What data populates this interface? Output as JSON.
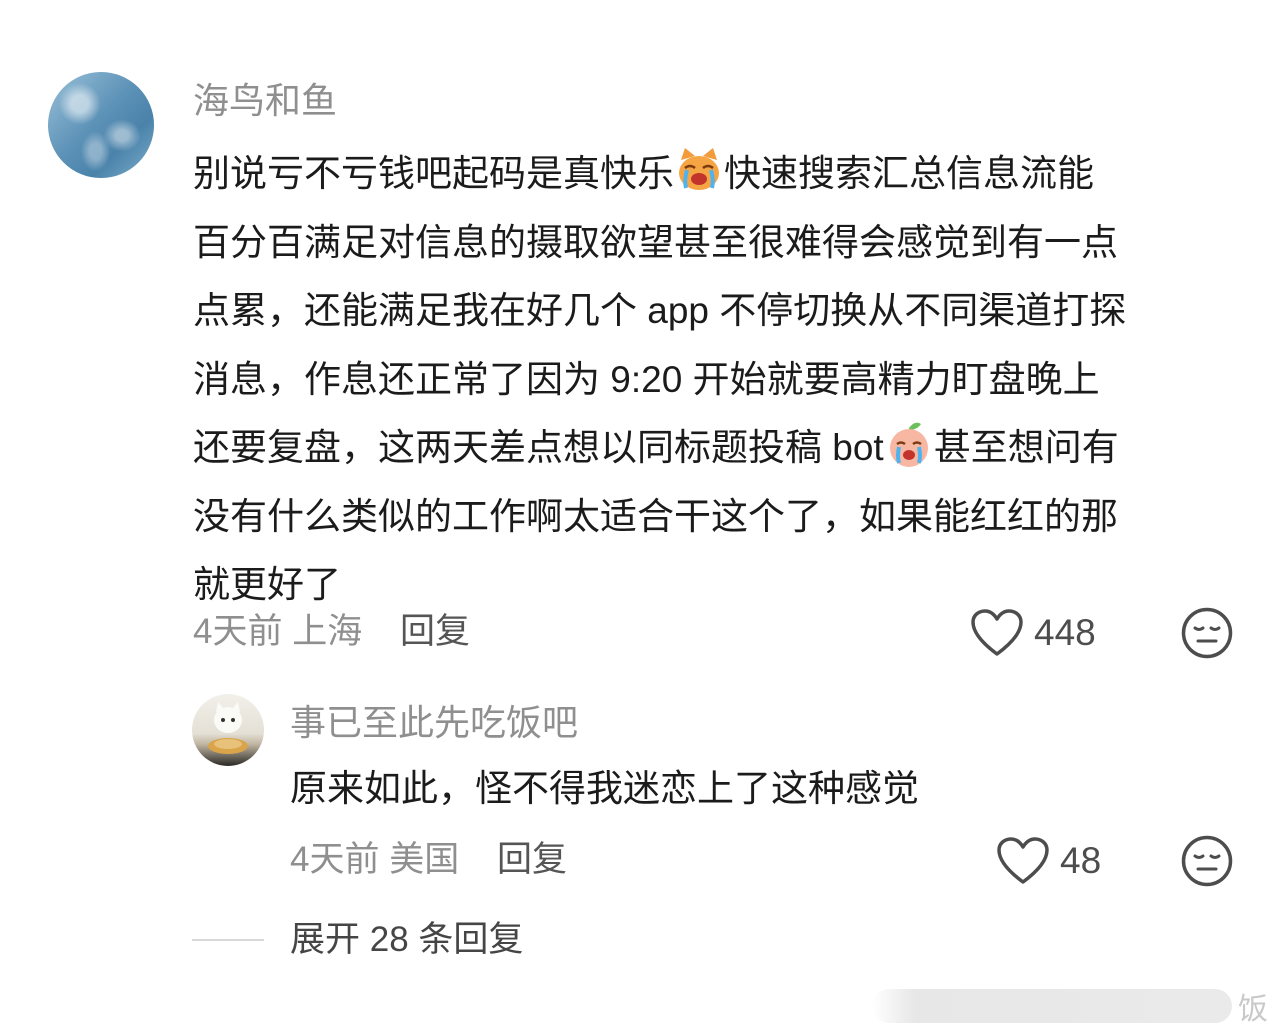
{
  "main_comment": {
    "username": "海鸟和鱼",
    "avatar_icon": "sea-waves-avatar",
    "lines": [
      "别说亏不亏钱吧起码是真快乐",
      "快速搜索汇总信息流能",
      "百分百满足对信息的摄取欲望甚至很难得会感觉到有一点",
      "点累，还能满足我在好几个 app 不停切换从不同渠道打探",
      "消息，作息还正常了因为 9:20 开始就要高精力盯盘晚上",
      "还要复盘，这两天差点想以同标题投稿 bot",
      "甚至想问有",
      "没有什么类似的工作啊太适合干这个了，如果能红红的那",
      "就更好了"
    ],
    "emoji_1": "crying-cat-emoji",
    "emoji_2": "crying-peach-emoji",
    "time": "4天前",
    "location": "上海",
    "reply_label": "回复",
    "likes": "448"
  },
  "reply_comment": {
    "username": "事已至此先吃饭吧",
    "avatar_icon": "cat-eating-noodles-avatar",
    "text": "原来如此，怪不得我迷恋上了这种感觉",
    "time": "4天前",
    "location": "美国",
    "reply_label": "回复",
    "likes": "48"
  },
  "expand": {
    "label": "展开 28 条回复"
  },
  "watermark": {
    "text": "饭"
  },
  "colors": {
    "text_primary": "#1b1b1b",
    "text_secondary": "#8f8f8f",
    "icon": "#4d4d4d"
  }
}
